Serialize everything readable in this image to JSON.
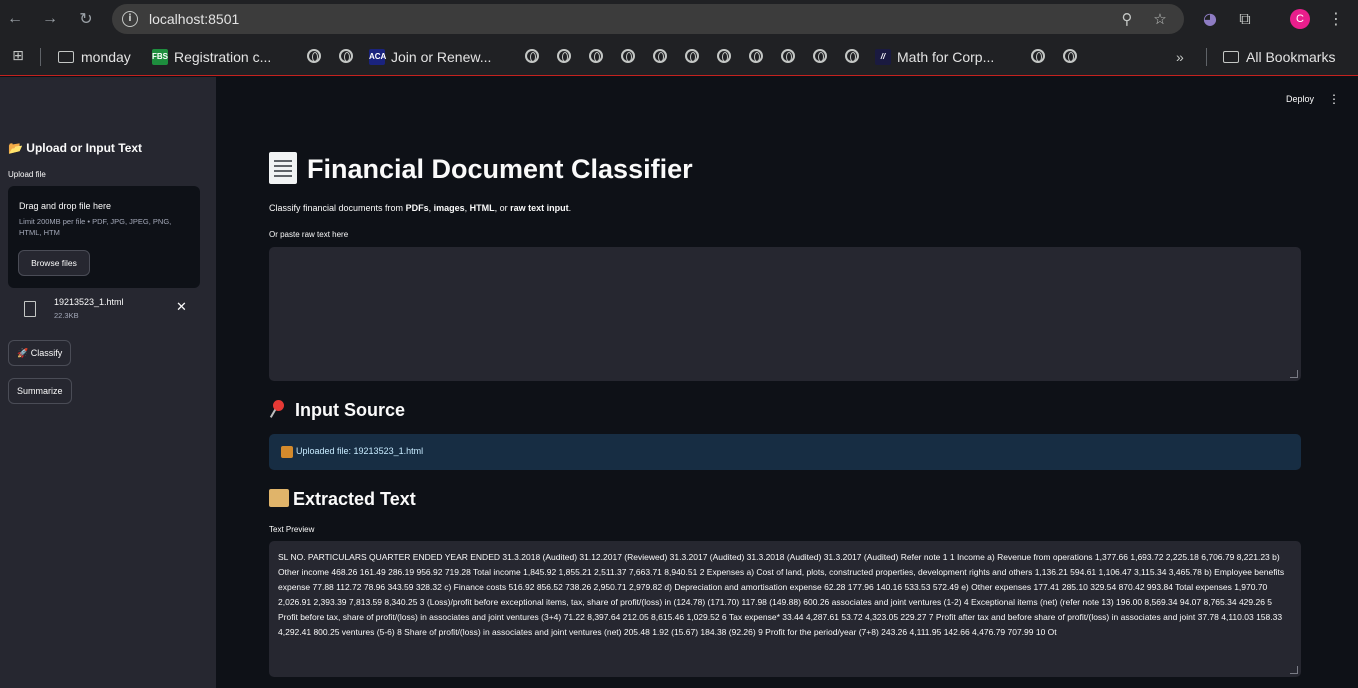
{
  "browser": {
    "url": "localhost:8501",
    "avatar_letter": "C",
    "icons": {
      "back": "back-arrow-icon",
      "forward": "forward-arrow-icon",
      "reload": "reload-icon",
      "site_info": "site-info-icon",
      "zoom": "zoom-icon",
      "bookmark_star": "star-icon",
      "extension_ghost": "ghost-extension-icon",
      "extensions": "puzzle-icon",
      "menu": "kebab-menu-icon"
    },
    "bookmarks": {
      "monday": "monday",
      "registration": "Registration c...",
      "registration_icon_text": "FBS",
      "join": "Join or Renew...",
      "join_icon_text": "ACA",
      "math": "Math for Corp...",
      "overflow": "»",
      "all": "All Bookmarks"
    }
  },
  "sidebar": {
    "title": "📂 Upload or Input Text",
    "upload_label": "Upload file",
    "dropzone_title": "Drag and drop file here",
    "dropzone_limit": "Limit 200MB per file • PDF, JPG, JPEG, PNG, HTML, HTM",
    "browse_button": "Browse files",
    "file_name": "19213523_1.html",
    "file_size": "22.3KB",
    "classify_button": "🚀 Classify",
    "summarize_button": "Summarize"
  },
  "header": {
    "deploy": "Deploy",
    "menu": "⋮"
  },
  "main": {
    "title": "Financial Document Classifier",
    "subtitle_prefix": "Classify financial documents from ",
    "subtitle_pdfs": "PDFs",
    "subtitle_sep1": ", ",
    "subtitle_images": "images",
    "subtitle_sep2": ", ",
    "subtitle_html": "HTML",
    "subtitle_sep3": ", or ",
    "subtitle_raw": "raw text input",
    "subtitle_end": ".",
    "paste_label": "Or paste raw text here",
    "paste_value": "",
    "input_source_heading": "Input Source",
    "input_source_text": "Uploaded file: 19213523_1.html",
    "extracted_heading": "Extracted Text",
    "preview_label": "Text Preview",
    "preview_text": "SL NO. PARTICULARS QUARTER ENDED YEAR ENDED 31.3.2018 (Audited) 31.12.2017 (Reviewed) 31.3.2017 (Audited) 31.3.2018 (Audited) 31.3.2017 (Audited) Refer note 1 1 Income a) Revenue from operations 1,377.66 1,693.72 2,225.18 6,706.79 8,221.23 b) Other income 468.26 161.49 286.19 956.92 719.28 Total income 1,845.92 1,855.21 2,511.37 7,663.71 8,940.51 2 Expenses a) Cost of land, plots, constructed properties, development rights and others 1,136.21 594.61 1,106.47 3,115.34 3,465.78 b) Employee benefits expense 77.88 112.72 78.96 343.59 328.32 c) Finance costs 516.92 856.52 738.26 2,950.71 2,979.82 d) Depreciation and amortisation expense 62.28 177.96 140.16 533.53 572.49 e) Other expenses 177.41 285.10 329.54 870.42 993.84 Total expenses 1,970.70 2,026.91 2,393.39 7,813.59 8,340.25 3 (Loss)/profit before exceptional items, tax, share of profit/(loss) in (124.78) (171.70) 117.98 (149.88) 600.26 associates and joint ventures (1-2) 4 Exceptional items (net) (refer note 13) 196.00 8,569.34 94.07 8,765.34 429.26 5 Profit before tax, share of profit/(loss) in associates and joint ventures (3+4) 71.22 8,397.64 212.05 8,615.46 1,029.52 6 Tax expense* 33.44 4,287.61 53.72 4,323.05 229.27 7 Profit after tax and before share of profit/(loss) in associates and joint 37.78 4,110.03 158.33 4,292.41 800.25 ventures (5-6) 8 Share of profit/(loss) in associates and joint ventures (net) 205.48 1.92 (15.67) 184.38 (92.26) 9 Profit for the period/year (7+8) 243.26 4,111.95 142.66 4,476.79 707.99 10 Ot"
  }
}
